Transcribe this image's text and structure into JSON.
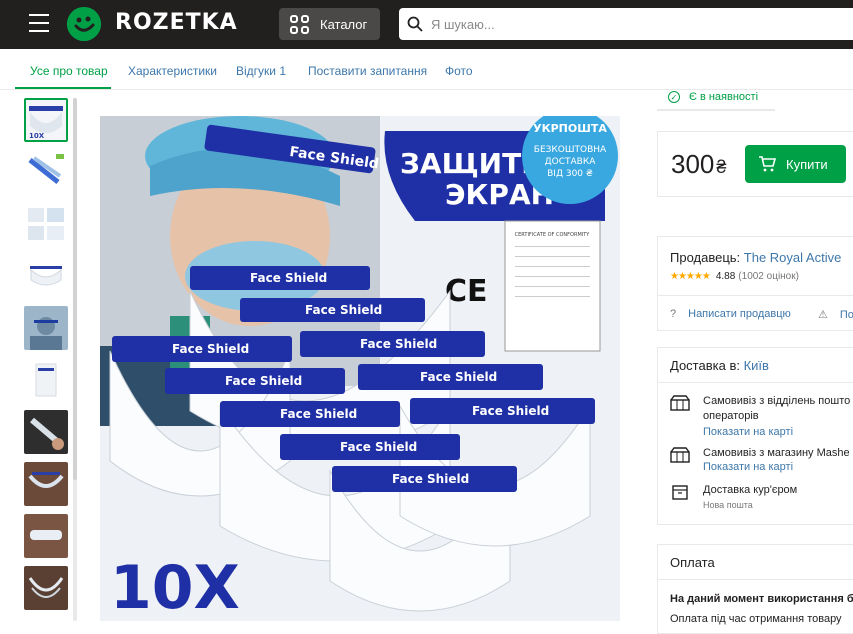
{
  "header": {
    "logo_text": "ROZETKA",
    "catalog_label": "Каталог",
    "search_placeholder": "Я шукаю..."
  },
  "tabs": [
    {
      "label": "Усе про товар",
      "active": true
    },
    {
      "label": "Характеристики"
    },
    {
      "label": "Відгуки 1"
    },
    {
      "label": "Поставити запитання"
    },
    {
      "label": "Фото"
    }
  ],
  "gallery": {
    "thumbnails_count": 10,
    "main_image": {
      "product_label": "Face Shield",
      "headline_line1": "ЗАЩИТНЫЙ",
      "headline_line2": "ЭКРАН",
      "promo_carrier": "УКРПОШТА",
      "promo_line1": "БЕЗКОШТОВНА",
      "promo_line2": "ДОСТАВКА",
      "promo_line3": "ВІД 300 ₴",
      "ce_mark": "CE",
      "certificate_title": "CERTIFICATE OF CONFORMITY",
      "quantity": "10X"
    }
  },
  "status": {
    "stock": "Є в наявності",
    "accent_color": "#00a046"
  },
  "purchase": {
    "price": "300",
    "currency": "₴",
    "buy_label": "Купити"
  },
  "seller": {
    "prefix": "Продавець:",
    "name": "The Royal Active",
    "rating_value": "4.88",
    "rating_count": "(1002 оцінок)",
    "write_label": "Написати продавцю",
    "complaint_label": "По"
  },
  "delivery": {
    "prefix": "Доставка в:",
    "city": "Київ",
    "options": [
      {
        "title_line1": "Самовивіз з відділень пошто",
        "title_line2": "операторів",
        "link": "Показати на карті"
      },
      {
        "title_line1": "Самовивіз з магазину Mashe",
        "link": "Показати на карті"
      },
      {
        "title_line1": "Доставка кур'єром",
        "sub": "Нова пошта"
      }
    ]
  },
  "payment": {
    "title": "Оплата",
    "bold_text": "На даний момент використання б",
    "text": "Оплата під час отримання товару"
  }
}
